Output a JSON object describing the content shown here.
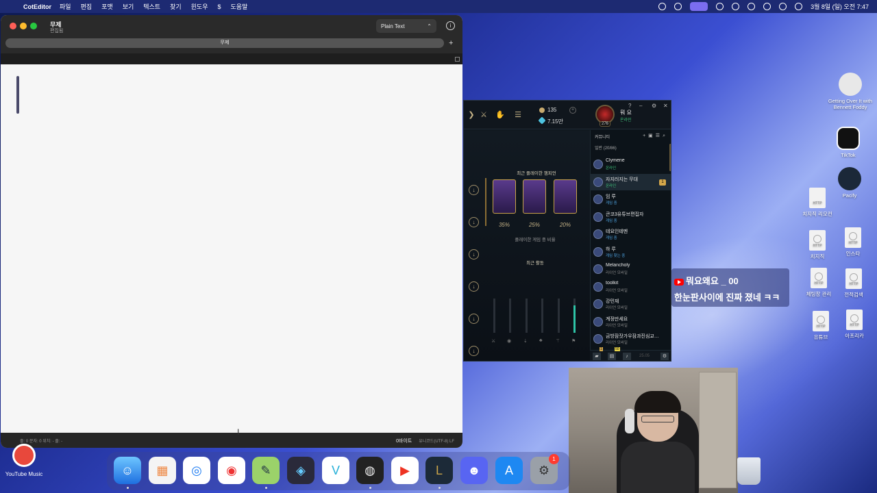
{
  "menubar": {
    "app_name": "CotEditor",
    "menus": [
      "파일",
      "편집",
      "포맷",
      "보기",
      "텍스트",
      "찾기",
      "윈도우",
      "$",
      "도움말"
    ],
    "clock": "3월 8일 (일) 오전 7:47"
  },
  "editor": {
    "doc_title": "무제",
    "doc_subtitle": "편집됨",
    "syntax": "Plain Text",
    "tab_label": "무제",
    "status_left": "줄: 0   문자: 0   위치: -   줄: -",
    "bytes": "0바이트",
    "encoding": "유니코드(UTF-8)  LF"
  },
  "lol": {
    "rp": "135",
    "be": "7.15만",
    "level": "276",
    "username": "뭐 요",
    "user_status": "온라인",
    "recent_title": "최근 플레이한 챔피언",
    "percents": [
      "35%",
      "25%",
      "20%"
    ],
    "play_ratio": "플레이한 게임 중 비율",
    "recent_activity": "최근 활동",
    "social_header": "커뮤니티",
    "group_label": "일반 (20/86)",
    "friends": [
      {
        "name": "Clymene",
        "status": "온라인",
        "color": "#3ec27a"
      },
      {
        "name": "자지러지는 무대",
        "status": "온라인",
        "color": "#3ec27a",
        "badge": "1"
      },
      {
        "name": "임 루",
        "status": "게임 중",
        "color": "#4ea3e0"
      },
      {
        "name": "큰코3유튜브편집자",
        "status": "게임 중",
        "color": "#4ea3e0"
      },
      {
        "name": "테요인테멘",
        "status": "게임 중",
        "color": "#4ea3e0"
      },
      {
        "name": "하 루",
        "status": "게임 찾는 중",
        "color": "#4ea3e0"
      },
      {
        "name": "Melancholy",
        "status": "리이언 모바일",
        "color": "#888888"
      },
      {
        "name": "toolkit",
        "status": "리이언 모바일",
        "color": "#888888"
      },
      {
        "name": "강민재",
        "status": "리이언 모바일",
        "color": "#888888"
      },
      {
        "name": "계정만세요",
        "status": "리이언 모바일",
        "color": "#888888"
      },
      {
        "name": "금방잠잣가우잠과진심교…",
        "status": "리이언 모바일",
        "color": "#888888"
      }
    ],
    "bottom_badge1": "1",
    "bottom_badge2": "50",
    "version": "25.05"
  },
  "subtitle": {
    "line1": "뭐요왜요 _ 00",
    "line2": "한눈판사이에 진짜 졌네 ㅋㅋ"
  },
  "desktop": {
    "icons": [
      {
        "label": "Getting Over It with Bennett Foddy"
      },
      {
        "label": "TikTok"
      },
      {
        "label": "Pacify"
      },
      {
        "label": "치지직 리모컨"
      },
      {
        "label": "치지직"
      },
      {
        "label": "인스타"
      },
      {
        "label": "체팅창 관리"
      },
      {
        "label": "전적검색"
      },
      {
        "label": "유튜브"
      },
      {
        "label": "아프리카"
      }
    ],
    "youtube_music": "YouTube Music"
  },
  "dock": {
    "badge": "1"
  }
}
